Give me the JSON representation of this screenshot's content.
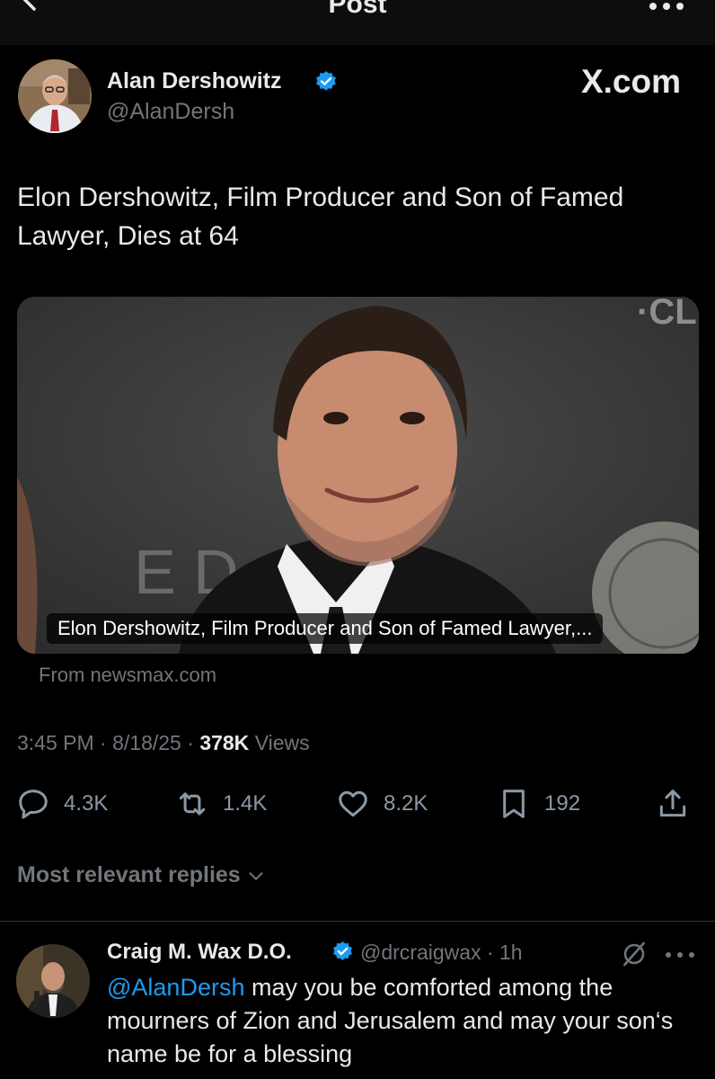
{
  "header": {
    "title": "Post"
  },
  "tweet": {
    "author_name": "Alan Dershowitz",
    "author_handle": "@AlanDersh",
    "site_mark": "X.com",
    "text": "Elon Dershowitz, Film Producer and Son of Famed Lawyer, Dies at 64",
    "card": {
      "caption": "Elon Dershowitz, Film Producer and Son of Famed Lawyer,...",
      "source": "From newsmax.com"
    },
    "time": "3:45 PM",
    "date": "8/18/25",
    "views_count": "378K",
    "views_label": "Views",
    "actions": {
      "replies": "4.3K",
      "reposts": "1.4K",
      "likes": "8.2K",
      "bookmarks": "192"
    }
  },
  "replies_filter": "Most relevant replies",
  "reply": {
    "author_name": "Craig M. Wax D.O.",
    "author_handle": "@drcraigwax",
    "age": "1h",
    "mention": "@AlanDersh",
    "text": " may you be comforted among the mourners of Zion and Jerusalem and may your son‘s name be for a blessing"
  },
  "colors": {
    "background": "#000000",
    "accent": "#1d9bf0",
    "muted": "#71767b",
    "text": "#e7e9ea"
  },
  "icons": [
    "back-arrow-icon",
    "more-icon",
    "verified-badge-icon",
    "reply-icon",
    "repost-icon",
    "like-icon",
    "bookmark-icon",
    "share-icon",
    "chevron-down-icon",
    "grok-icon"
  ]
}
